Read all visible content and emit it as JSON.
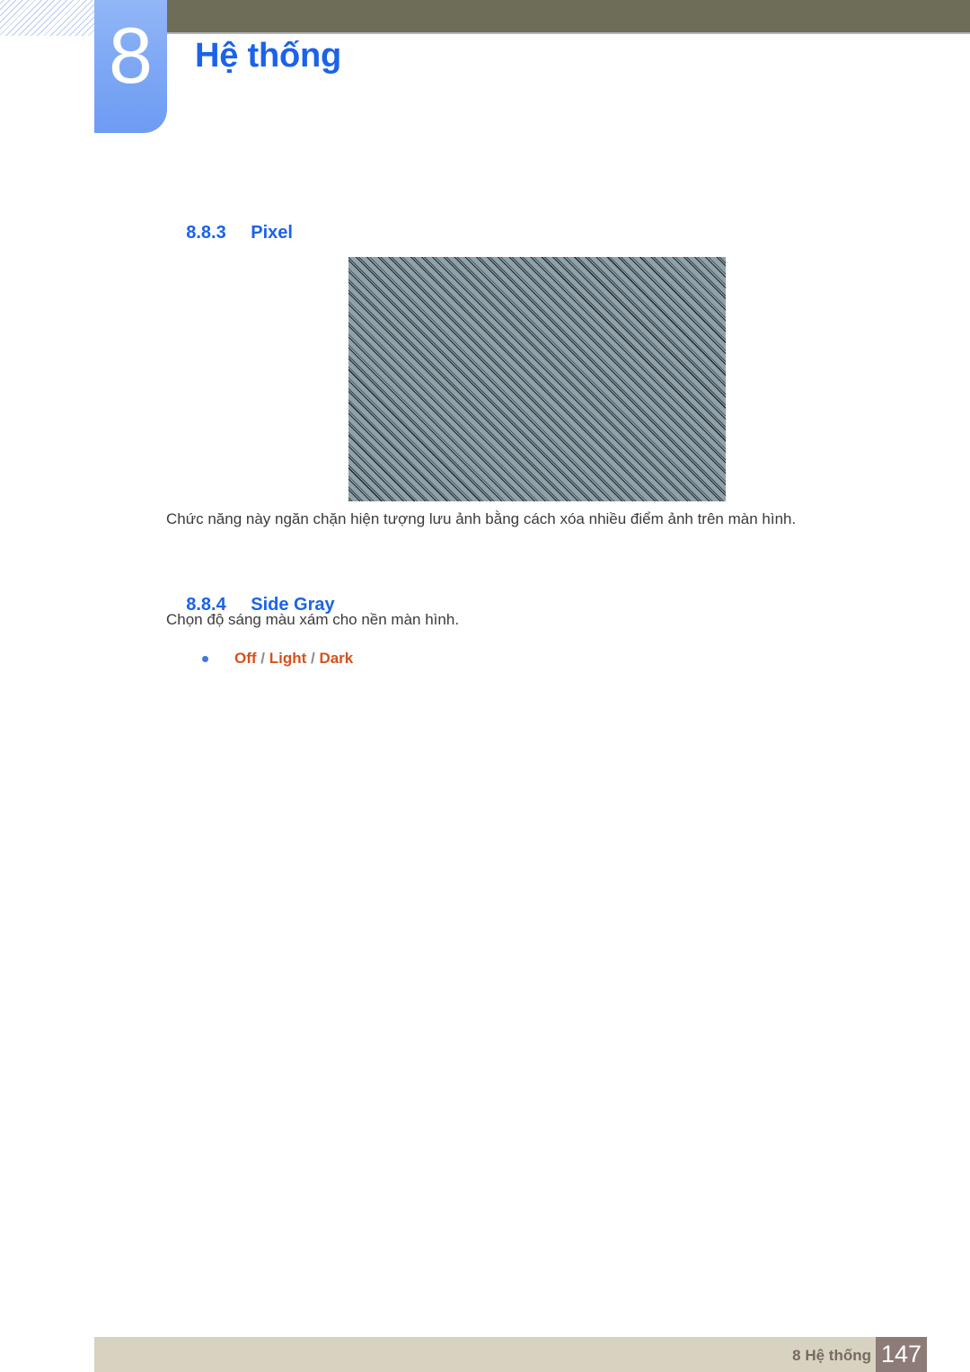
{
  "page": {
    "chapter_number": "8",
    "chapter_title": "Hệ thống"
  },
  "sections": {
    "pixel": {
      "number": "8.8.3",
      "title": "Pixel",
      "figure_alt": "pixel-pattern-screen",
      "paragraph": "Chức năng này ngăn chặn hiện tượng lưu ảnh bằng cách xóa nhiều điểm ảnh trên màn hình."
    },
    "side_gray": {
      "number": "8.8.4",
      "title": "Side Gray",
      "paragraph": "Chọn độ sáng màu xám cho nền màn hình.",
      "options": {
        "off": "Off",
        "light": "Light",
        "dark": "Dark",
        "separator": " / "
      }
    }
  },
  "footer": {
    "label": "8 Hệ thống",
    "page_number": "147"
  },
  "colors": {
    "heading_blue": "#1b63e8",
    "title_blue": "#1b63e8",
    "option_orange": "#d9501c",
    "top_bar_olive": "#6e6d57",
    "tab_blue": "#7fa9f5",
    "footer_bar": "#d8d3c0",
    "footer_page_box": "#8c7b76",
    "figure_background": "#8ea2aa"
  }
}
